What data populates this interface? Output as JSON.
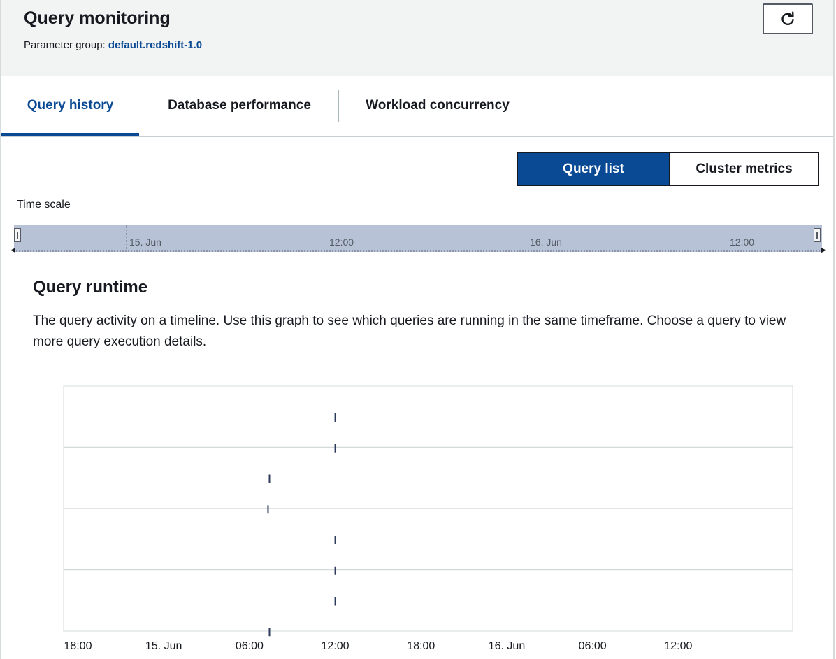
{
  "header": {
    "title": "Query monitoring",
    "param_label": "Parameter group:",
    "param_value": "default.redshift-1.0",
    "refresh_icon": "refresh-icon"
  },
  "tabs": [
    {
      "label": "Query history",
      "active": true
    },
    {
      "label": "Database performance",
      "active": false
    },
    {
      "label": "Workload concurrency",
      "active": false
    }
  ],
  "view_toggle": {
    "options": [
      "Query list",
      "Cluster metrics"
    ],
    "selected": "Query list"
  },
  "time_scale": {
    "label": "Time scale",
    "ticks": [
      "15. Jun",
      "12:00",
      "16. Jun",
      "12:00"
    ]
  },
  "query_runtime": {
    "title": "Query runtime",
    "description": "The query activity on a timeline. Use this graph to see which queries are running in the same timeframe. Choose a query to view more query execution details."
  },
  "chart_data": {
    "type": "scatter",
    "x_ticks": [
      "18:00",
      "15. Jun",
      "06:00",
      "12:00",
      "18:00",
      "16. Jun",
      "06:00",
      "12:00"
    ],
    "x_tick_hours": [
      0,
      6,
      12,
      18,
      24,
      30,
      36,
      42
    ],
    "x_range_hours": [
      -1,
      50
    ],
    "grid": true,
    "row_count": 7,
    "points": [
      {
        "row": 0,
        "hour": 18.0
      },
      {
        "row": 1,
        "hour": 18.0
      },
      {
        "row": 2,
        "hour": 13.4
      },
      {
        "row": 3,
        "hour": 13.3
      },
      {
        "row": 4,
        "hour": 18.0
      },
      {
        "row": 5,
        "hour": 18.0
      },
      {
        "row": 6,
        "hour": 18.0
      },
      {
        "row": 7,
        "hour": 13.4
      }
    ],
    "colors": {
      "mark": "#2d3a5a",
      "grid": "#d5dbdb",
      "axis_text": "#16191f"
    }
  },
  "colors": {
    "accent": "#0a4a94",
    "header_bg": "#f2f3f3",
    "navigator_bg": "#b8c2d6"
  }
}
